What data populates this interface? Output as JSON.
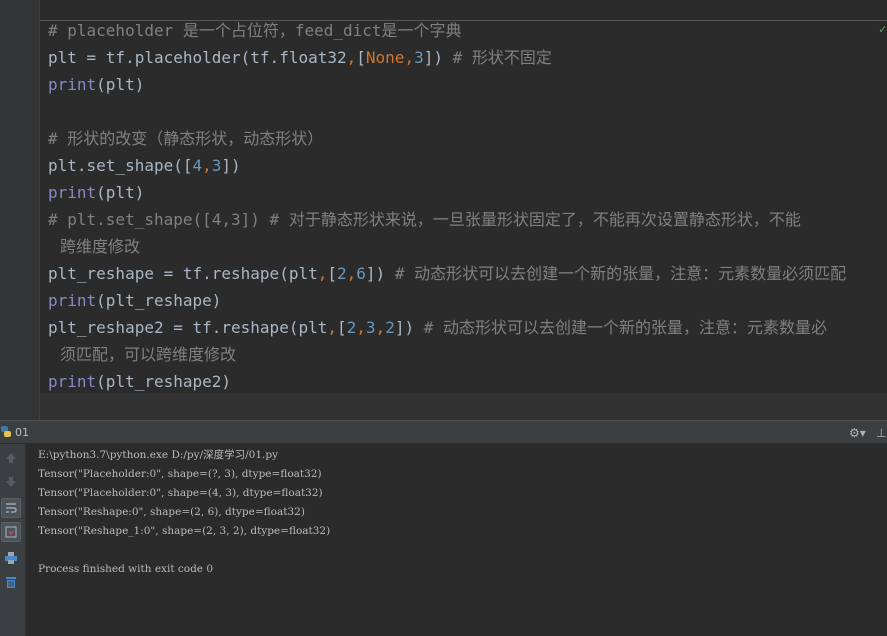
{
  "editor": {
    "corner_mark": "✓",
    "lines": [
      {
        "segments": [
          {
            "t": "# placeholder 是一个占位符，feed_dict是一个字典",
            "c": "comment"
          }
        ]
      },
      {
        "segments": [
          {
            "t": "plt = tf.placeholder(tf.float32",
            "c": ""
          },
          {
            "t": ",",
            "c": "punc"
          },
          {
            "t": "[",
            "c": ""
          },
          {
            "t": "None",
            "c": "kw"
          },
          {
            "t": ",",
            "c": "punc"
          },
          {
            "t": "3",
            "c": "number"
          },
          {
            "t": "]) ",
            "c": ""
          },
          {
            "t": "# 形状不固定",
            "c": "comment"
          }
        ]
      },
      {
        "segments": [
          {
            "t": "print",
            "c": "builtin"
          },
          {
            "t": "(plt)",
            "c": ""
          }
        ]
      },
      {
        "segments": [
          {
            "t": "",
            "c": ""
          }
        ]
      },
      {
        "segments": [
          {
            "t": "# 形状的改变（静态形状，动态形状）",
            "c": "comment"
          }
        ]
      },
      {
        "segments": [
          {
            "t": "plt.set_shape([",
            "c": ""
          },
          {
            "t": "4",
            "c": "number"
          },
          {
            "t": ",",
            "c": "punc"
          },
          {
            "t": "3",
            "c": "number"
          },
          {
            "t": "])",
            "c": ""
          }
        ]
      },
      {
        "segments": [
          {
            "t": "print",
            "c": "builtin"
          },
          {
            "t": "(plt)",
            "c": ""
          }
        ]
      },
      {
        "segments": [
          {
            "t": "# plt.set_shape([4,3]) # 对于静态形状来说，一旦张量形状固定了，不能再次设置静态形状，不能",
            "c": "comment"
          }
        ]
      },
      {
        "cont": true,
        "segments": [
          {
            "t": "跨维度修改",
            "c": "comment"
          }
        ]
      },
      {
        "segments": [
          {
            "t": "plt_reshape = tf.reshape(plt",
            "c": ""
          },
          {
            "t": ",",
            "c": "punc"
          },
          {
            "t": "[",
            "c": ""
          },
          {
            "t": "2",
            "c": "number"
          },
          {
            "t": ",",
            "c": "punc"
          },
          {
            "t": "6",
            "c": "number"
          },
          {
            "t": "]) ",
            "c": ""
          },
          {
            "t": "# 动态形状可以去创建一个新的张量，注意：元素数量必须匹配",
            "c": "comment"
          }
        ]
      },
      {
        "segments": [
          {
            "t": "print",
            "c": "builtin"
          },
          {
            "t": "(plt_reshape)",
            "c": ""
          }
        ]
      },
      {
        "segments": [
          {
            "t": "plt_reshape2 = tf.reshape(plt",
            "c": ""
          },
          {
            "t": ",",
            "c": "punc"
          },
          {
            "t": "[",
            "c": ""
          },
          {
            "t": "2",
            "c": "number"
          },
          {
            "t": ",",
            "c": "punc"
          },
          {
            "t": "3",
            "c": "number"
          },
          {
            "t": ",",
            "c": "punc"
          },
          {
            "t": "2",
            "c": "number"
          },
          {
            "t": "]) ",
            "c": ""
          },
          {
            "t": "# 动态形状可以去创建一个新的张量，注意：元素数量必",
            "c": "comment"
          }
        ]
      },
      {
        "cont": true,
        "segments": [
          {
            "t": "须匹配，可以跨维度修改",
            "c": "comment"
          }
        ]
      },
      {
        "segments": [
          {
            "t": "print",
            "c": "builtin"
          },
          {
            "t": "(plt_reshape2)",
            "c": ""
          }
        ]
      }
    ]
  },
  "run_panel": {
    "tab_label": "01",
    "settings_label": "⚙▾",
    "hide_label": "⊥",
    "console_lines": [
      "E:\\python3.7\\python.exe D:/py/深度学习/01.py",
      "Tensor(\"Placeholder:0\", shape=(?, 3), dtype=float32)",
      "Tensor(\"Placeholder:0\", shape=(4, 3), dtype=float32)",
      "Tensor(\"Reshape:0\", shape=(2, 6), dtype=float32)",
      "Tensor(\"Reshape_1:0\", shape=(2, 3, 2), dtype=float32)",
      "",
      "Process finished with exit code 0"
    ]
  },
  "icons": {
    "run_tab": "python-icon",
    "toolbar": [
      "up-arrow-icon",
      "down-arrow-icon",
      "soft-wrap-icon",
      "scroll-to-end-icon",
      "print-icon",
      "trash-icon"
    ]
  },
  "colors": {
    "background": "#2b2b2b",
    "comment": "#808080",
    "builtin": "#8888c6",
    "number": "#6897bb",
    "keyword": "#cc7832",
    "text": "#a9b7c6"
  }
}
